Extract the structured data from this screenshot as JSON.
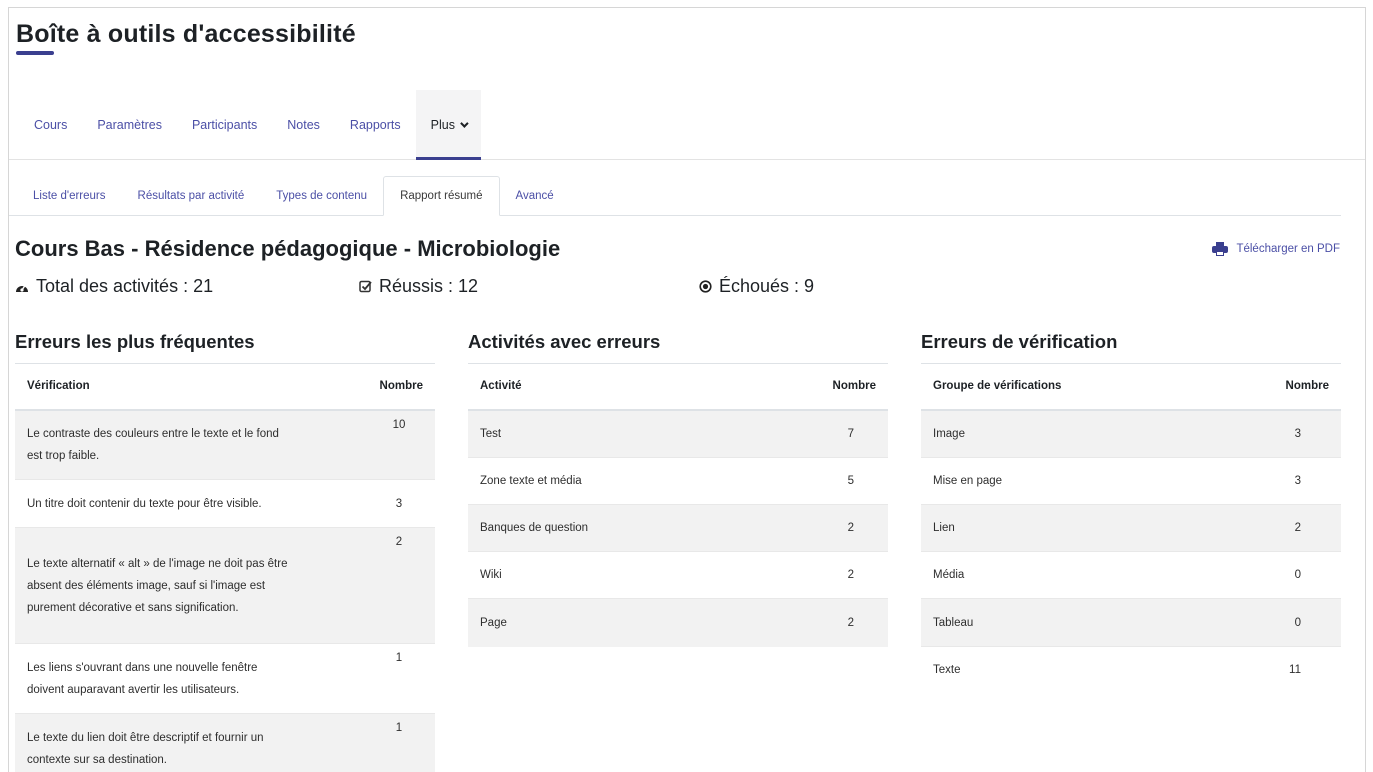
{
  "page_title": "Boîte à outils d'accessibilité",
  "primary_nav": [
    {
      "label": "Cours"
    },
    {
      "label": "Paramètres"
    },
    {
      "label": "Participants"
    },
    {
      "label": "Notes"
    },
    {
      "label": "Rapports"
    },
    {
      "label": "Plus"
    }
  ],
  "secondary_nav": [
    {
      "label": "Liste d'erreurs"
    },
    {
      "label": "Résultats par activité"
    },
    {
      "label": "Types de contenu"
    },
    {
      "label": "Rapport résumé"
    },
    {
      "label": "Avancé"
    }
  ],
  "course_title": "Cours Bas - Résidence pédagogique - Microbiologie",
  "pdf_link": "Télécharger en PDF",
  "stats": {
    "total": "Total des activités : 21",
    "passed": "Réussis : 12",
    "failed": "Échoués : 9"
  },
  "icons": {
    "total": "tachometer-icon",
    "passed": "check-square-icon",
    "failed": "dot-circle-icon",
    "pdf": "printer-icon"
  },
  "colors": {
    "link": "#4b4fa6",
    "accent": "#3a3f8f",
    "row_alt": "#f2f2f2"
  },
  "frequent_errors": {
    "heading": "Erreurs les plus fréquentes",
    "col_check": "Vérification",
    "col_count": "Nombre",
    "rows": [
      {
        "text": "Le contraste des couleurs entre le texte et le fond est trop faible.",
        "count": "10"
      },
      {
        "text": "Un titre doit contenir du texte pour être visible.",
        "count": "3"
      },
      {
        "text": "Le texte alternatif « alt » de l'image ne doit pas être absent des éléments image, sauf si l'image est purement décorative et sans signification.",
        "count": "2"
      },
      {
        "text": "Les liens s'ouvrant dans une nouvelle fenêtre doivent auparavant avertir les utilisateurs.",
        "count": "1"
      },
      {
        "text": "Le texte du lien doit être descriptif et fournir un contexte sur sa destination.",
        "count": "1"
      }
    ]
  },
  "activities": {
    "heading": "Activités avec erreurs",
    "col_activity": "Activité",
    "col_count": "Nombre",
    "rows": [
      {
        "name": "Test",
        "count": "7"
      },
      {
        "name": "Zone texte et média",
        "count": "5"
      },
      {
        "name": "Banques de question",
        "count": "2"
      },
      {
        "name": "Wiki",
        "count": "2"
      },
      {
        "name": "Page",
        "count": "2"
      }
    ]
  },
  "check_errors": {
    "heading": "Erreurs de vérification",
    "col_group": "Groupe de vérifications",
    "col_count": "Nombre",
    "rows": [
      {
        "name": "Image",
        "count": "3"
      },
      {
        "name": "Mise en page",
        "count": "3"
      },
      {
        "name": "Lien",
        "count": "2"
      },
      {
        "name": "Média",
        "count": "0"
      },
      {
        "name": "Tableau",
        "count": "0"
      },
      {
        "name": "Texte",
        "count": "11"
      }
    ]
  }
}
